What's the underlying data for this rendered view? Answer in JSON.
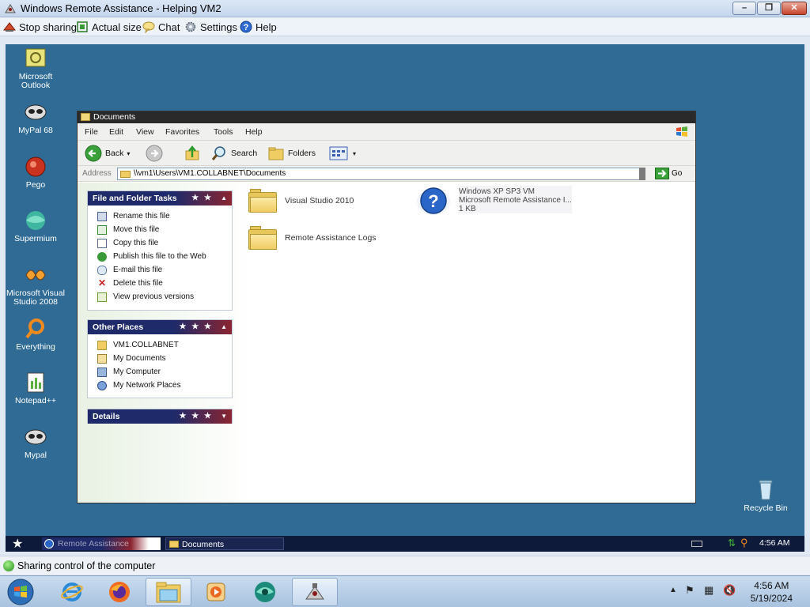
{
  "window": {
    "title": "Windows Remote Assistance - Helping VM2",
    "minimize": "–",
    "maximize": "❐",
    "close": "✕"
  },
  "toolbar": {
    "stop_sharing": "Stop sharing",
    "actual_size": "Actual size",
    "chat": "Chat",
    "settings": "Settings",
    "help": "Help"
  },
  "desktop_icons": [
    {
      "label": "Microsoft Outlook",
      "icon": "outlook-icon"
    },
    {
      "label": "MyPal 68",
      "icon": "raccoon-icon"
    },
    {
      "label": "Pego",
      "icon": "pego-icon"
    },
    {
      "label": "Supermium",
      "icon": "supermium-icon"
    },
    {
      "label": "Microsoft Visual Studio 2008",
      "icon": "visual-studio-icon"
    },
    {
      "label": "Everything",
      "icon": "search-icon"
    },
    {
      "label": "Notepad++",
      "icon": "notepadpp-icon"
    },
    {
      "label": "Mypal",
      "icon": "raccoon-icon"
    }
  ],
  "recycle_bin": "Recycle Bin",
  "explorer": {
    "title": "Documents",
    "menu": [
      "File",
      "Edit",
      "View",
      "Favorites",
      "Tools",
      "Help"
    ],
    "back": "Back",
    "search": "Search",
    "folders": "Folders",
    "address_label": "Address",
    "address": "\\\\vm1\\Users\\VM1.COLLABNET\\Documents",
    "go": "Go",
    "file_tasks": {
      "title": "File and Folder Tasks",
      "items": [
        "Rename this file",
        "Move this file",
        "Copy this file",
        "Publish this file to the Web",
        "E-mail this file",
        "Delete this file",
        "View previous versions"
      ]
    },
    "other_places": {
      "title": "Other Places",
      "items": [
        "VM1.COLLABNET",
        "My Documents",
        "My Computer",
        "My Network Places"
      ]
    },
    "details": {
      "title": "Details"
    },
    "files": [
      {
        "name": "Visual Studio 2010",
        "type": "folder"
      },
      {
        "name": "Remote Assistance Logs",
        "type": "folder"
      }
    ],
    "ra_file": {
      "name": "Windows XP SP3 VM",
      "desc": "Microsoft Remote Assistance I...",
      "size": "1 KB"
    }
  },
  "xp_taskbar": {
    "items": [
      "Remote Assistance",
      "Documents"
    ],
    "time": "4:56 AM"
  },
  "status": {
    "text": "Sharing control of the computer"
  },
  "win7_taskbar": {
    "time": "4:56 AM",
    "date": "5/19/2024"
  },
  "colors": {
    "desktop": "#2f6b94",
    "task_header_navy": "#1e2a6a",
    "task_header_red": "#8b2530"
  }
}
